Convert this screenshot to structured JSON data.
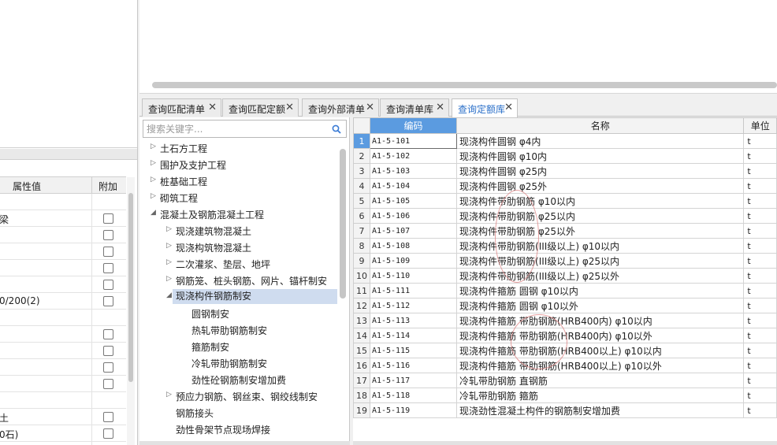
{
  "property_panel": {
    "header": {
      "value_label": "属性值",
      "extra_label": "附加"
    },
    "rows": [
      {
        "value": "",
        "has_checkbox": false
      },
      {
        "value": "梁",
        "has_checkbox": true
      },
      {
        "value": "",
        "has_checkbox": true
      },
      {
        "value": "",
        "has_checkbox": true
      },
      {
        "value": "",
        "has_checkbox": true
      },
      {
        "value": "",
        "has_checkbox": true
      },
      {
        "value": "0/200(2)",
        "has_checkbox": true
      },
      {
        "value": "",
        "has_checkbox": false
      },
      {
        "value": "",
        "has_checkbox": true
      },
      {
        "value": "",
        "has_checkbox": true
      },
      {
        "value": "",
        "has_checkbox": true
      },
      {
        "value": "",
        "has_checkbox": true
      },
      {
        "value": "",
        "has_checkbox": false
      },
      {
        "value": "土",
        "has_checkbox": true
      },
      {
        "value": "0石)",
        "has_checkbox": true
      },
      {
        "value": "",
        "has_checkbox": true
      }
    ]
  },
  "tabs": [
    {
      "label": "查询匹配清单",
      "active": false
    },
    {
      "label": "查询匹配定额",
      "active": false
    },
    {
      "label": "查询外部清单",
      "active": false
    },
    {
      "label": "查询清单库",
      "active": false
    },
    {
      "label": "查询定额库",
      "active": true
    }
  ],
  "search": {
    "placeholder": "搜索关键字..."
  },
  "tree": [
    {
      "label": "土石方工程",
      "level": 0,
      "arrow": "collapsed"
    },
    {
      "label": "围护及支护工程",
      "level": 0,
      "arrow": "collapsed"
    },
    {
      "label": "桩基础工程",
      "level": 0,
      "arrow": "collapsed"
    },
    {
      "label": "砌筑工程",
      "level": 0,
      "arrow": "collapsed"
    },
    {
      "label": "混凝土及钢筋混凝土工程",
      "level": 0,
      "arrow": "expanded"
    },
    {
      "label": "现浇建筑物混凝土",
      "level": 1,
      "arrow": "collapsed"
    },
    {
      "label": "现浇构筑物混凝土",
      "level": 1,
      "arrow": "collapsed"
    },
    {
      "label": "二次灌浆、垫层、地坪",
      "level": 1,
      "arrow": "collapsed"
    },
    {
      "label": "钢筋笼、桩头钢筋、网片、锚杆制安",
      "level": 1,
      "arrow": "collapsed"
    },
    {
      "label": "现浇构件钢筋制安",
      "level": 1,
      "arrow": "expanded",
      "selected": true
    },
    {
      "label": "圆钢制安",
      "level": 2,
      "arrow": ""
    },
    {
      "label": "热轧带肋钢筋制安",
      "level": 2,
      "arrow": ""
    },
    {
      "label": "箍筋制安",
      "level": 2,
      "arrow": ""
    },
    {
      "label": "冷轧带肋钢筋制安",
      "level": 2,
      "arrow": ""
    },
    {
      "label": "劲性砼钢筋制安增加费",
      "level": 2,
      "arrow": ""
    },
    {
      "label": "预应力钢筋、钢丝束、钢绞线制安",
      "level": 1,
      "arrow": "collapsed"
    },
    {
      "label": "钢筋接头",
      "level": 1,
      "arrow": ""
    },
    {
      "label": "劲性骨架节点现场焊接",
      "level": 1,
      "arrow": ""
    }
  ],
  "grid": {
    "headers": {
      "code": "编码",
      "name": "名称",
      "unit": "单位"
    },
    "rows": [
      {
        "n": "1",
        "code": "A1-5-101",
        "name": "现浇构件圆钢 φ4内",
        "unit": "t"
      },
      {
        "n": "2",
        "code": "A1-5-102",
        "name": "现浇构件圆钢 φ10内",
        "unit": "t"
      },
      {
        "n": "3",
        "code": "A1-5-103",
        "name": "现浇构件圆钢 φ25内",
        "unit": "t"
      },
      {
        "n": "4",
        "code": "A1-5-104",
        "name": "现浇构件圆钢 φ25外",
        "unit": "t"
      },
      {
        "n": "5",
        "code": "A1-5-105",
        "name": "现浇构件带肋钢筋 φ10以内",
        "unit": "t"
      },
      {
        "n": "6",
        "code": "A1-5-106",
        "name": "现浇构件带肋钢筋 φ25以内",
        "unit": "t"
      },
      {
        "n": "7",
        "code": "A1-5-107",
        "name": "现浇构件带肋钢筋 φ25以外",
        "unit": "t"
      },
      {
        "n": "8",
        "code": "A1-5-108",
        "name": "现浇构件带肋钢筋(III级以上) φ10以内",
        "unit": "t"
      },
      {
        "n": "9",
        "code": "A1-5-109",
        "name": "现浇构件带肋钢筋(III级以上) φ25以内",
        "unit": "t"
      },
      {
        "n": "10",
        "code": "A1-5-110",
        "name": "现浇构件带肋钢筋(III级以上) φ25以外",
        "unit": "t"
      },
      {
        "n": "11",
        "code": "A1-5-111",
        "name": "现浇构件箍筋 圆钢 φ10以内",
        "unit": "t"
      },
      {
        "n": "12",
        "code": "A1-5-112",
        "name": "现浇构件箍筋 圆钢 φ10以外",
        "unit": "t"
      },
      {
        "n": "13",
        "code": "A1-5-113",
        "name": "现浇构件箍筋 带肋钢筋(HRB400内) φ10以内",
        "unit": "t"
      },
      {
        "n": "14",
        "code": "A1-5-114",
        "name": "现浇构件箍筋 带肋钢筋(HRB400内) φ10以外",
        "unit": "t"
      },
      {
        "n": "15",
        "code": "A1-5-115",
        "name": "现浇构件箍筋 带肋钢筋(HRB400以上) φ10以内",
        "unit": "t"
      },
      {
        "n": "16",
        "code": "A1-5-116",
        "name": "现浇构件箍筋 带肋钢筋(HRB400以上) φ10以外",
        "unit": "t"
      },
      {
        "n": "17",
        "code": "A1-5-117",
        "name": "冷轧带肋钢筋 直钢筋",
        "unit": "t"
      },
      {
        "n": "18",
        "code": "A1-5-118",
        "name": "冷轧带肋钢筋 箍筋",
        "unit": "t"
      },
      {
        "n": "19",
        "code": "A1-5-119",
        "name": "现浇劲性混凝土构件的钢筋制安增加费",
        "unit": "t"
      }
    ]
  },
  "icons": {
    "tab_close": "close-icon",
    "search": "search-icon"
  },
  "colors": {
    "accent": "#5b9be0",
    "selected_tree": "#cfdcef",
    "active_tab_text": "#2a6fc9"
  }
}
